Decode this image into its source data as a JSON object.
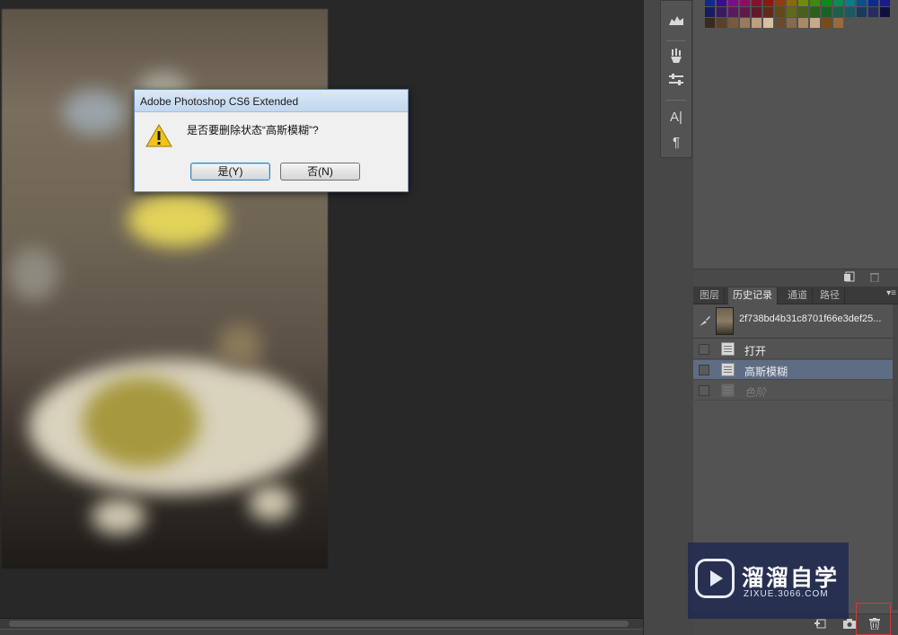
{
  "dialog": {
    "title": "Adobe Photoshop CS6 Extended",
    "message": "是否要删除状态“高斯模糊”?",
    "yes_label": "是(Y)",
    "no_label": "否(N)",
    "icon": "warning-icon"
  },
  "history_panel": {
    "tabs": [
      {
        "label": "图层",
        "active": false
      },
      {
        "label": "历史记录",
        "active": true
      },
      {
        "label": "通道",
        "active": false
      },
      {
        "label": "路径",
        "active": false
      }
    ],
    "menu_icon": "▾≡",
    "snapshot_name": "2f738bd4b31c8701f66e3def25...",
    "states": [
      {
        "label": "打开",
        "selected": false,
        "ghost": false
      },
      {
        "label": "高斯模糊",
        "selected": true,
        "ghost": false
      },
      {
        "label": "色阶",
        "selected": false,
        "ghost": true
      }
    ]
  },
  "tools": {
    "icons": [
      "levels-icon",
      "brush-settings-icon",
      "adjustments-icon",
      "character-icon",
      "paragraph-icon"
    ],
    "character_glyph": "A|",
    "paragraph_glyph": "¶"
  },
  "watermark": {
    "title": "溜溜自学",
    "url": "ZIXUE.3066.COM"
  },
  "colors": {
    "dialog_title_bg": "#c2d6ee",
    "selected_row": "#5f6d84",
    "trash_highlight": "#d23b3b",
    "watermark_bg": "#1e2850"
  },
  "swatches": [
    [
      "#0e2a8a",
      "#3a0e8a",
      "#7a0e8a",
      "#8a0e63",
      "#8a0e2e",
      "#8a1a0e",
      "#8a3f0e",
      "#8a6a0e",
      "#6f8a0e",
      "#3f8a0e",
      "#0e8a1a",
      "#0e8a52",
      "#0e7a8a",
      "#0e4f8a",
      "#0e2a8a",
      "#1a1a8a"
    ],
    [
      "#1a1a60",
      "#3a1a60",
      "#5a1a60",
      "#601a4a",
      "#601a2a",
      "#602a1a",
      "#604a1a",
      "#606a1a",
      "#4a601a",
      "#2a601a",
      "#1a602a",
      "#1a604a",
      "#1a5a60",
      "#1a3a60",
      "#2a2a60",
      "#101040"
    ],
    [
      "#3a2a1a",
      "#5a3f2a",
      "#7a5a3a",
      "#9a7a5a",
      "#baa080",
      "#d8c0a0",
      "#6a4a2a",
      "#8a6a4a",
      "#a88a6a",
      "#c8aa8a",
      "#7a4a1a",
      "#9a6a3a",
      "",
      "",
      "",
      ""
    ]
  ]
}
